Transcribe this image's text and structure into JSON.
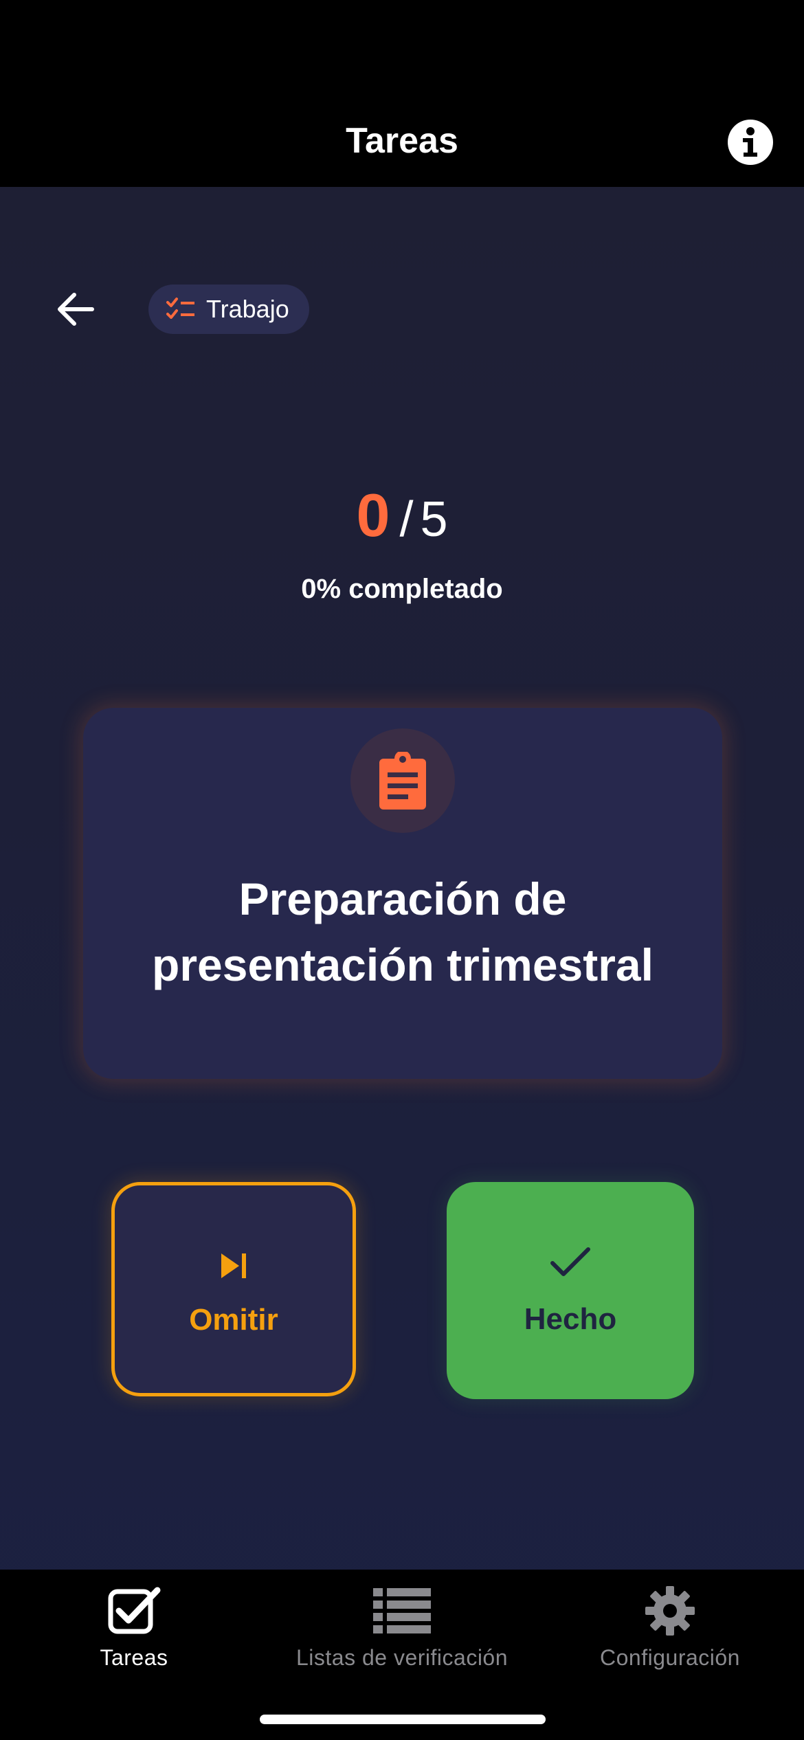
{
  "header": {
    "title": "Tareas",
    "info_icon": "info-icon"
  },
  "category": {
    "label": "Trabajo",
    "icon": "checklist-icon"
  },
  "progress": {
    "done": "0",
    "separator": "/",
    "total": "5",
    "percent_label": "0% completado"
  },
  "task": {
    "icon": "clipboard-icon",
    "title": "Preparación de presentación trimestral"
  },
  "actions": {
    "skip_label": "Omitir",
    "done_label": "Hecho"
  },
  "nav": {
    "items": [
      {
        "label": "Tareas",
        "icon": "checkbox-icon",
        "active": true
      },
      {
        "label": "Listas de verificación",
        "icon": "list-icon",
        "active": false
      },
      {
        "label": "Configuración",
        "icon": "gear-icon",
        "active": false
      }
    ]
  },
  "colors": {
    "accent_orange": "#ff6b3d",
    "skip_amber": "#f5a00f",
    "done_green": "#4caf50",
    "background": "#1f1f33",
    "card": "#27284d"
  }
}
